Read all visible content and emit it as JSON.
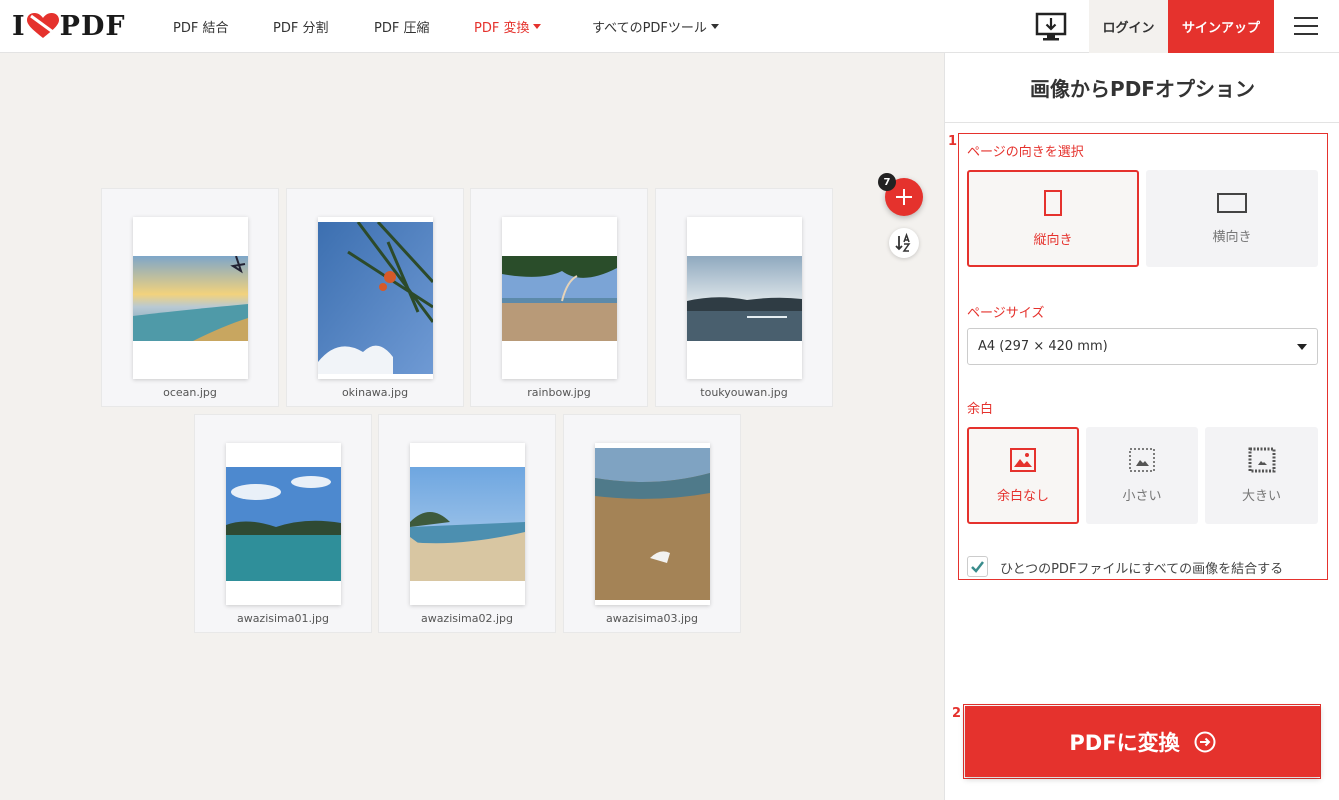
{
  "header": {
    "logo_text_left": "I",
    "logo_text_right": "PDF",
    "nav": [
      {
        "label": "PDF 結合"
      },
      {
        "label": "PDF 分割"
      },
      {
        "label": "PDF 圧縮"
      },
      {
        "label": "PDF 変換"
      },
      {
        "label": "すべてのPDFツール"
      }
    ],
    "login_label": "ログイン",
    "signup_label": "サインアップ",
    "accent_color": "#e5322d"
  },
  "workspace": {
    "file_count": "7",
    "files": [
      {
        "name": "ocean.jpg"
      },
      {
        "name": "okinawa.jpg"
      },
      {
        "name": "rainbow.jpg"
      },
      {
        "name": "toukyouwan.jpg"
      },
      {
        "name": "awazisima01.jpg"
      },
      {
        "name": "awazisima02.jpg"
      },
      {
        "name": "awazisima03.jpg"
      }
    ]
  },
  "sidebar": {
    "title": "画像からPDFオプション",
    "marker_1": "1",
    "marker_2": "2",
    "orientation": {
      "label": "ページの向きを選択",
      "options": [
        {
          "label": "縦向き",
          "selected": true
        },
        {
          "label": "横向き",
          "selected": false
        }
      ]
    },
    "page_size": {
      "label": "ページサイズ",
      "value": "A4 (297 × 420 mm)"
    },
    "margin": {
      "label": "余白",
      "options": [
        {
          "label": "余白なし",
          "selected": true
        },
        {
          "label": "小さい",
          "selected": false
        },
        {
          "label": "大きい",
          "selected": false
        }
      ]
    },
    "merge_checkbox": {
      "label": "ひとつのPDFファイルにすべての画像を結合する",
      "checked": true
    },
    "convert_button": "PDFに変換"
  }
}
